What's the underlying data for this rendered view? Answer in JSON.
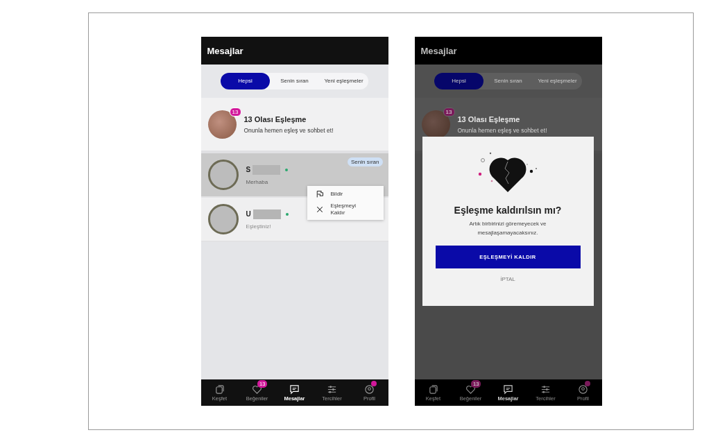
{
  "phones": [
    {
      "title": "Mesajlar",
      "tabs": [
        {
          "label": "Hepsi",
          "selected": true
        },
        {
          "label": "Senin sıran",
          "selected": false
        },
        {
          "label": "Yeni eşleşmeler",
          "selected": false
        }
      ],
      "promo": {
        "badge": "13",
        "title": "13 Olası Eşleşme",
        "subtitle": "Onunla hemen eşleş ve sohbet et!"
      },
      "chats": [
        {
          "initial": "S",
          "message": "Merhaba",
          "tag": "Senin sıran",
          "online": true,
          "selected": true
        },
        {
          "initial": "U",
          "message": "Eşleştiniz!",
          "online": true,
          "selected": false
        }
      ],
      "menu": [
        {
          "kind": "flag",
          "label": "Bildir"
        },
        {
          "kind": "close",
          "label": "Eşleşmeyi Kaldır"
        }
      ],
      "nav": [
        {
          "kind": "discover",
          "label": "Keşfet",
          "selected": false
        },
        {
          "kind": "likes",
          "label": "Beğeniler",
          "badge": "13",
          "selected": false
        },
        {
          "kind": "messages",
          "label": "Mesajlar",
          "selected": true
        },
        {
          "kind": "preferences",
          "label": "Tercihler",
          "selected": false
        },
        {
          "kind": "profile",
          "label": "Profil",
          "dot": true,
          "selected": false
        }
      ]
    },
    {
      "title": "Mesajlar",
      "tabs": [
        {
          "label": "Hepsi",
          "selected": true
        },
        {
          "label": "Senin sıran",
          "selected": false
        },
        {
          "label": "Yeni eşleşmeler",
          "selected": false
        }
      ],
      "promo": {
        "badge": "13",
        "title": "13 Olası Eşleşme",
        "subtitle": "Onunla hemen eşleş ve sohbet et!"
      },
      "dialog": {
        "title": "Eşleşme kaldırılsın mı?",
        "text": "Artık birbirinizi göremeyecek ve mesajlaşamayacaksınız.",
        "confirm": "EŞLEŞMEYİ KALDIR",
        "cancel": "İPTAL"
      },
      "nav": [
        {
          "kind": "discover",
          "label": "Keşfet",
          "selected": false
        },
        {
          "kind": "likes",
          "label": "Beğeniler",
          "badge": "13",
          "selected": false
        },
        {
          "kind": "messages",
          "label": "Mesajlar",
          "selected": true
        },
        {
          "kind": "preferences",
          "label": "Tercihler",
          "selected": false
        },
        {
          "kind": "profile",
          "label": "Profil",
          "dot": true,
          "selected": false
        }
      ]
    }
  ]
}
